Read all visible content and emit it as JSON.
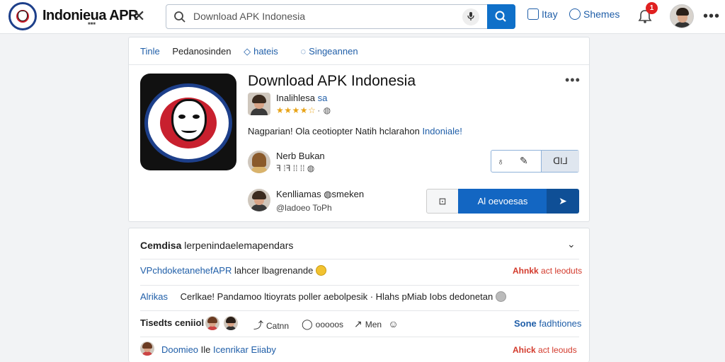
{
  "topbar": {
    "brand": "Indonieua APR",
    "brand_sub": "■■■",
    "close_glyph": "✕",
    "search_placeholder": "Download APK Indonesia",
    "nav": [
      {
        "label": "Itay"
      },
      {
        "label": "Shemes"
      }
    ],
    "notification_count": "1",
    "more_glyph": "•••"
  },
  "crumbs": {
    "c1": "Tinle",
    "c2": "Pedanosinden",
    "c3": "hateis",
    "c4": "Singeannen"
  },
  "app": {
    "title": "Download APK Indonesia",
    "more_glyph": "•••",
    "developer_prefix": "Inalihlesa",
    "developer_highlight": "sa",
    "stars": "★★★★☆",
    "rating_suffix": "· ◍",
    "description_prefix": "Nagparian! Ola ceotiopter Natih hclarahon",
    "description_highlight": "Indoniale!"
  },
  "users": [
    {
      "name": "Nerb Bukan",
      "name_highlight": "",
      "meta": "ꟻ ⁞ꟻ ⁞⁞ ⁞⁞ ◍"
    },
    {
      "name": "Kenlliamas ◍smeken",
      "meta": "@ladoeo ToPh"
    }
  ],
  "buttons": {
    "like_glyph": "♁",
    "edit_glyph": "✎",
    "group_right": "ᗡI⅃",
    "small_glyph": "⊡",
    "primary": "Al oevoesas",
    "side_glyph": "➤"
  },
  "comments": {
    "header": "Cemdisa",
    "header_rest": "lerpenindaelemapendars",
    "chevron": "⌄",
    "rows": [
      {
        "lead": "VPchdoketanehefAPR",
        "text": "lahcer lbagrenande",
        "red": "Ahnkk",
        "red_rest": "act leoduts"
      },
      {
        "lead": "Alrikas",
        "text": "Cerlkae! Pandamoo ltioyrats poller aebolpesik · Hlahs pMiab Iobs dedonetan"
      },
      {
        "lead": "Tisedts ceniiol",
        "tool1": "Catnn",
        "tool2": "ooooos",
        "tool3": "Men",
        "blue": "Sone",
        "blue_rest": "fadhtiones"
      },
      {
        "lead": "Doomieo",
        "lead_rest": "Ile",
        "text_link": "Icenrikar Eiiaby",
        "red": "Ahick",
        "red_rest": "act leouds"
      }
    ]
  },
  "colors": {
    "accent": "#1366c2",
    "link": "#1f5ea8",
    "danger": "#d33a2c",
    "badge": "#e02020"
  }
}
